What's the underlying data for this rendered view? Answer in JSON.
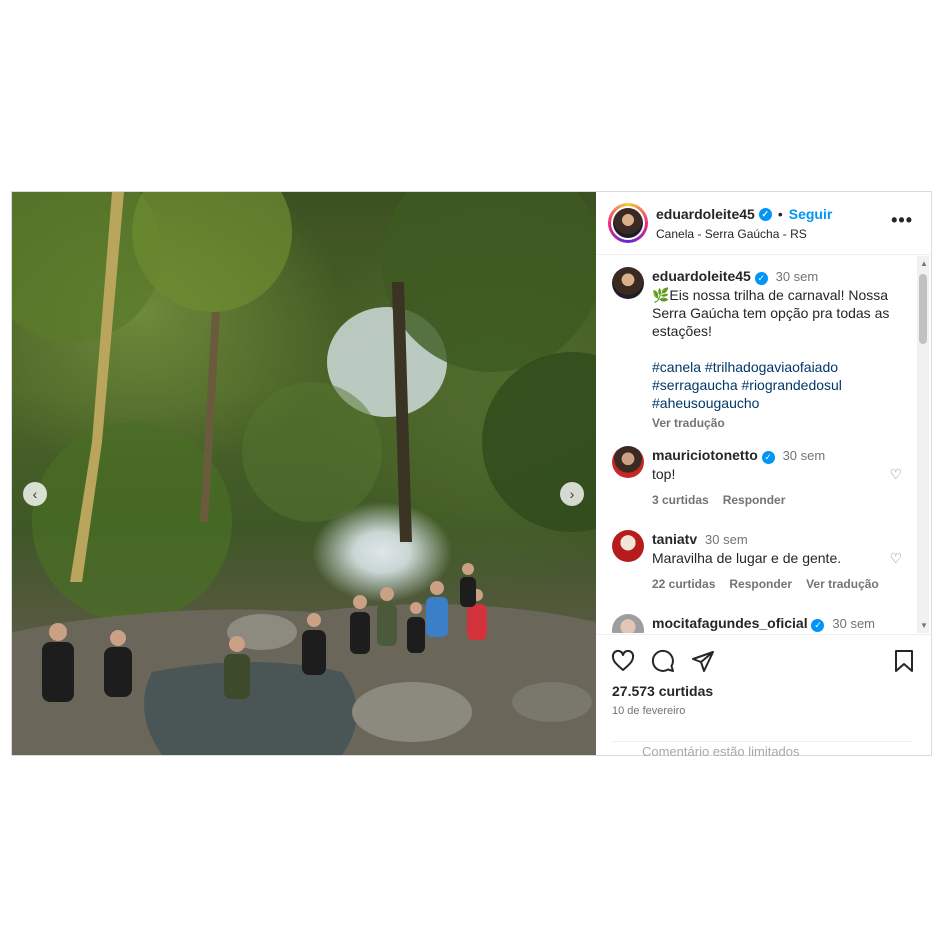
{
  "post": {
    "username": "eduardoleite45",
    "follow_label": "Seguir",
    "location": "Canela - Serra Gaúcha - RS",
    "more_icon": "more-icon"
  },
  "caption": {
    "username": "eduardoleite45",
    "time": "30 sem",
    "text_line1": "🌿Eis nossa trilha de carnaval! Nossa Serra Gaúcha tem opção pra todas as estações!",
    "hashtags": "#canela #trilhadogaviaofaiado #serragaucha #riograndedosul #aheusougaucho",
    "translate": "Ver tradução"
  },
  "comments": [
    {
      "username": "mauriciotonetto",
      "time": "30 sem",
      "text": "top!",
      "likes": "3 curtidas",
      "reply": "Responder",
      "translate": ""
    },
    {
      "username": "taniatv",
      "time": "30 sem",
      "text": "Maravilha de lugar e de gente.",
      "likes": "22 curtidas",
      "reply": "Responder",
      "translate": "Ver tradução"
    },
    {
      "username": "mocitafagundes_oficial",
      "time": "30 sem",
      "text": "",
      "likes": "",
      "reply": "",
      "translate": ""
    }
  ],
  "actions": {
    "likes": "27.573 curtidas",
    "date": "10 de fevereiro",
    "add_comment_placeholder": "Comentário estão limitados"
  },
  "colors": {
    "accent": "#0095f6",
    "hashtag": "#00376b",
    "muted": "#737373"
  }
}
